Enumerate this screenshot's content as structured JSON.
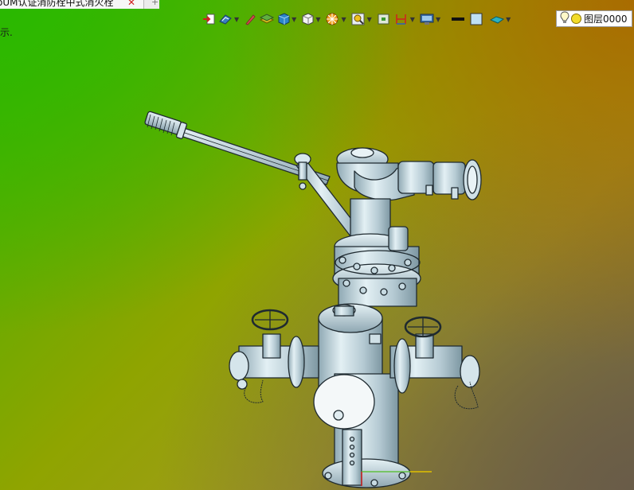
{
  "document_tab": {
    "title": "oUM认证消防栓中式消火栓",
    "close_glyph": "✕",
    "add_glyph": "+"
  },
  "viewport": {
    "hint_text": "示."
  },
  "toolbar": {
    "buttons": [
      {
        "icon": "exit-sketch-icon"
      },
      {
        "icon": "display-style-icon",
        "dropdown": true
      },
      {
        "icon": "pencil-icon"
      },
      {
        "icon": "layers-stack-icon"
      },
      {
        "icon": "blue-cube-icon",
        "dropdown": true
      },
      {
        "icon": "white-cube-icon",
        "dropdown": true
      },
      {
        "icon": "section-wheel-icon",
        "dropdown": true
      },
      {
        "icon": "zoom-icon",
        "dropdown": true
      },
      {
        "icon": "fit-view-icon"
      },
      {
        "icon": "measure-icon",
        "dropdown": true
      },
      {
        "icon": "monitor-icon",
        "dropdown": true
      },
      {
        "icon": "line-color-icon"
      },
      {
        "icon": "fill-color-icon"
      },
      {
        "icon": "surface-icon",
        "dropdown": true
      }
    ]
  },
  "layer": {
    "label": "图层0000",
    "lamp_icon": "lightbulb-icon",
    "state_icon": "layer-on-icon"
  },
  "colors": {
    "background_top_left": "#3db400",
    "background_top_right": "#aa6900",
    "background_bottom_right": "#695c48",
    "model": "#b7cdd6",
    "model_edge": "#1f2a30"
  }
}
